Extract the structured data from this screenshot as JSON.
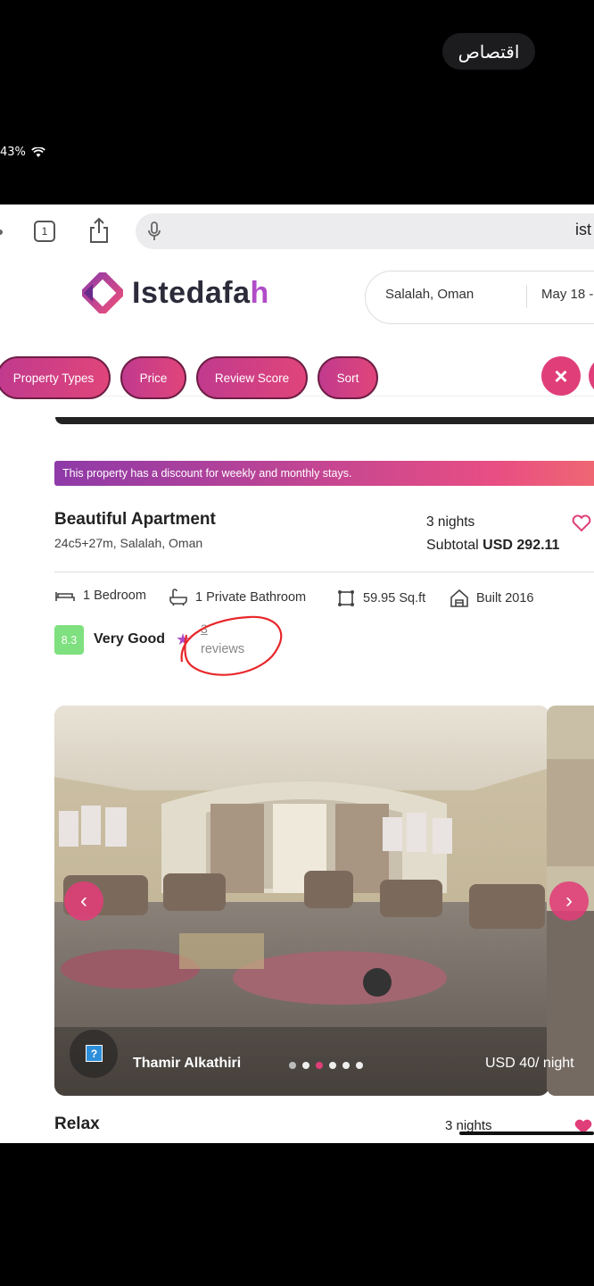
{
  "crop_button": {
    "label": "اقتصاص"
  },
  "status_bar": {
    "battery": "43%"
  },
  "browser": {
    "tab_count": "1",
    "url_partial": "ist"
  },
  "header": {
    "logo_text": "Istedafa",
    "logo_text_accent": "h",
    "search": {
      "location": "Salalah, Oman",
      "dates": "May 18 -"
    }
  },
  "filters": {
    "chips": [
      "Property Types",
      "Price",
      "Review Score",
      "Sort"
    ],
    "clear_icon": "×"
  },
  "listing": {
    "discount_banner": "This property has a discount for weekly and monthly stays.",
    "title": "Beautiful Apartment",
    "address": "24c5+27m, Salalah, Oman",
    "nights": "3 nights",
    "subtotal_label": "Subtotal",
    "subtotal_value": "USD 292.11",
    "amenities": [
      "1 Bedroom",
      "1 Private Bathroom",
      "59.95 Sq.ft",
      "Built 2016"
    ],
    "score": "8.3",
    "score_label": "Very Good",
    "review_count": "3",
    "review_label": "reviews",
    "host_name": "Thamir Alkathiri",
    "price_per_night": "USD 40/ night",
    "carousel_dots": 6,
    "carousel_active": 2
  },
  "next_listing": {
    "title": "Relax",
    "nights": "3 nights"
  },
  "colors": {
    "brand_pink": "#e03e78",
    "brand_purple": "#b04cc8",
    "score_green": "#7ee07e"
  }
}
